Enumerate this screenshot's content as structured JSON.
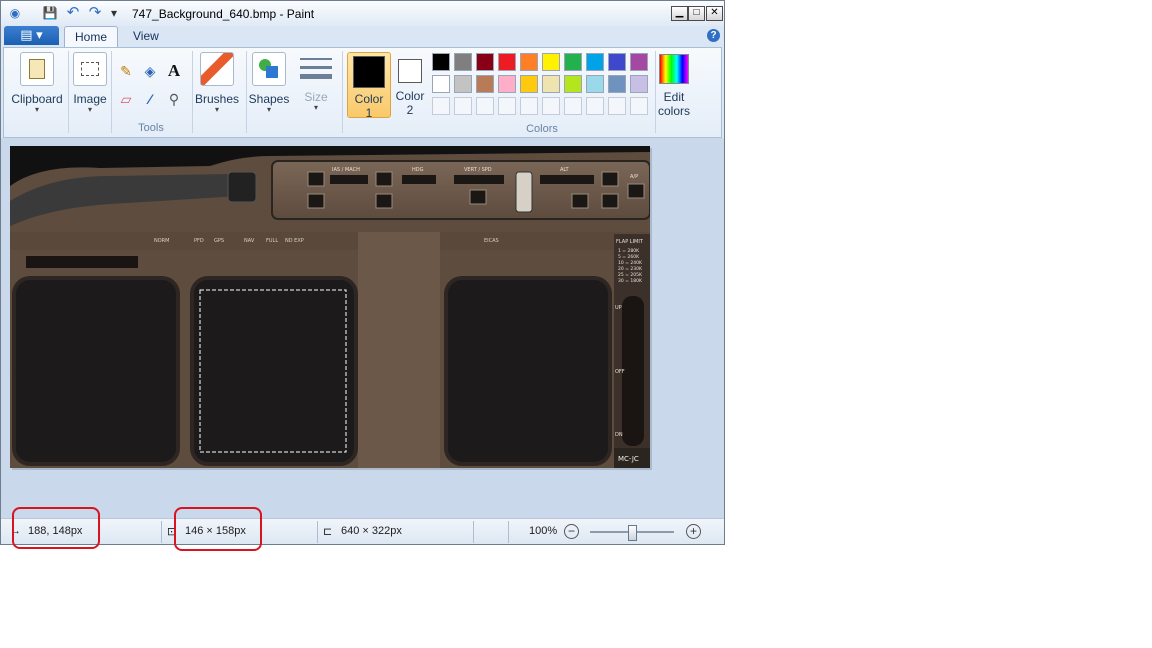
{
  "window": {
    "title": "747_Background_640.bmp - Paint",
    "qa_save": "💾",
    "qa_undo": "↶",
    "qa_redo": "↷",
    "qa_menu": "▾",
    "app_icon": "paint-palette-icon",
    "minimize": "▁",
    "maximize": "□",
    "close": "✕"
  },
  "ribbon": {
    "file_button": "▤ ▾",
    "tabs": [
      {
        "label": "Home"
      },
      {
        "label": "View"
      }
    ],
    "help": "?",
    "clipboard": {
      "label": "Clipboard",
      "arrow": "▾"
    },
    "image": {
      "label": "Image",
      "arrow": "▾"
    },
    "tools": {
      "label": "Tools",
      "items": [
        {
          "name": "pencil-icon",
          "glyph": "✎"
        },
        {
          "name": "fill-bucket-icon",
          "glyph": "◈"
        },
        {
          "name": "text-icon",
          "glyph": "A"
        },
        {
          "name": "eraser-icon",
          "glyph": "▱"
        },
        {
          "name": "color-picker-icon",
          "glyph": "⁄"
        },
        {
          "name": "magnifier-icon",
          "glyph": "⚲"
        }
      ]
    },
    "brushes": {
      "label": "Brushes",
      "arrow": "▾"
    },
    "shapes": {
      "label": "Shapes",
      "arrow": "▾"
    },
    "size": {
      "label": "Size",
      "arrow": "▾"
    },
    "color1": {
      "line1": "Color",
      "line2": "1",
      "value": "#000000"
    },
    "color2": {
      "line1": "Color",
      "line2": "2",
      "value": "#ffffff"
    },
    "colors_label": "Colors",
    "palette_row1": [
      "#000000",
      "#7f7f7f",
      "#880015",
      "#ed1c24",
      "#ff7f27",
      "#fff200",
      "#22b14c",
      "#00a2e8",
      "#3f48cc",
      "#a349a4"
    ],
    "palette_row2": [
      "#ffffff",
      "#c3c3c3",
      "#b97a57",
      "#ffaec9",
      "#ffc90e",
      "#efe4b0",
      "#b5e61d",
      "#99d9ea",
      "#7092be",
      "#c8bfe7"
    ],
    "palette_row3_empty": 10,
    "edit_colors": {
      "line1": "Edit",
      "line2": "colors"
    }
  },
  "canvas": {
    "panel_labels": {
      "ias": "IAS / MACH",
      "hdg": "HDG",
      "vert": "VERT / SPD",
      "alt": "ALT",
      "ap": "A/P",
      "norm": "NORM",
      "pfd": "PFD",
      "gps": "GPS",
      "nav": "NAV",
      "full": "FULL",
      "nd_exp": "ND EXP",
      "eicas": "EICAS",
      "flap_limit": "FLAP LIMIT",
      "flap_rows": [
        "1 = 280K",
        "5 = 260K",
        "10 = 240K",
        "20 = 230K",
        "25 = 205K",
        "30 = 180K"
      ],
      "up": "UP",
      "off": "OFF",
      "dn": "DN",
      "mcjc": "MC-JC"
    }
  },
  "status": {
    "cursor_icon": "↔",
    "cursor_pos": "188, 148px",
    "selection_icon": "⊡",
    "selection_size": "146 × 158px",
    "image_icon": "⊏",
    "image_size": "640 × 322px",
    "zoom": "100%",
    "zoom_out": "−",
    "zoom_in": "+",
    "zoom_level": 1.0
  },
  "annotation_color": "#d8141e"
}
